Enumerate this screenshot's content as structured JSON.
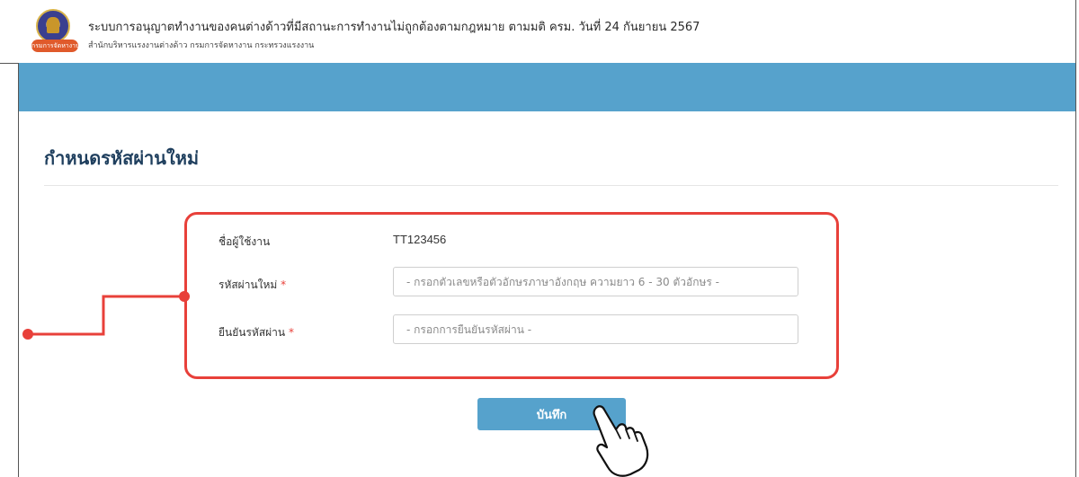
{
  "header": {
    "title": "ระบบการอนุญาตทำงานของคนต่างด้าวที่มีสถานะการทำงานไม่ถูกต้องตามกฎหมาย ตามมติ ครม. วันที่ 24 กันยายน 2567",
    "subtitle": "สำนักบริหารแรงงานต่างด้าว  กรมการจัดหางาน  กระทรวงแรงงาน",
    "logo_text": "กรมการจัดหางาน"
  },
  "page": {
    "title": "กำหนดรหัสผ่านใหม่"
  },
  "form": {
    "username_label": "ชื่อผู้ใช้งาน",
    "username_value": "TT123456",
    "new_password_label": "รหัสผ่านใหม่",
    "new_password_placeholder": "- กรอกตัวเลขหรือตัวอักษรภาษาอังกฤษ ความยาว 6 - 30 ตัวอักษร -",
    "confirm_password_label": "ยืนยันรหัสผ่าน",
    "confirm_password_placeholder": "- กรอกการยืนยันรหัสผ่าน -",
    "required_mark": "*",
    "save_label": "บันทึก"
  },
  "colors": {
    "accent_blue": "#56a2cc",
    "highlight_red": "#e8403a",
    "title_navy": "#1f3f5e"
  },
  "icons": {
    "cursor": "pointing-hand-icon"
  }
}
